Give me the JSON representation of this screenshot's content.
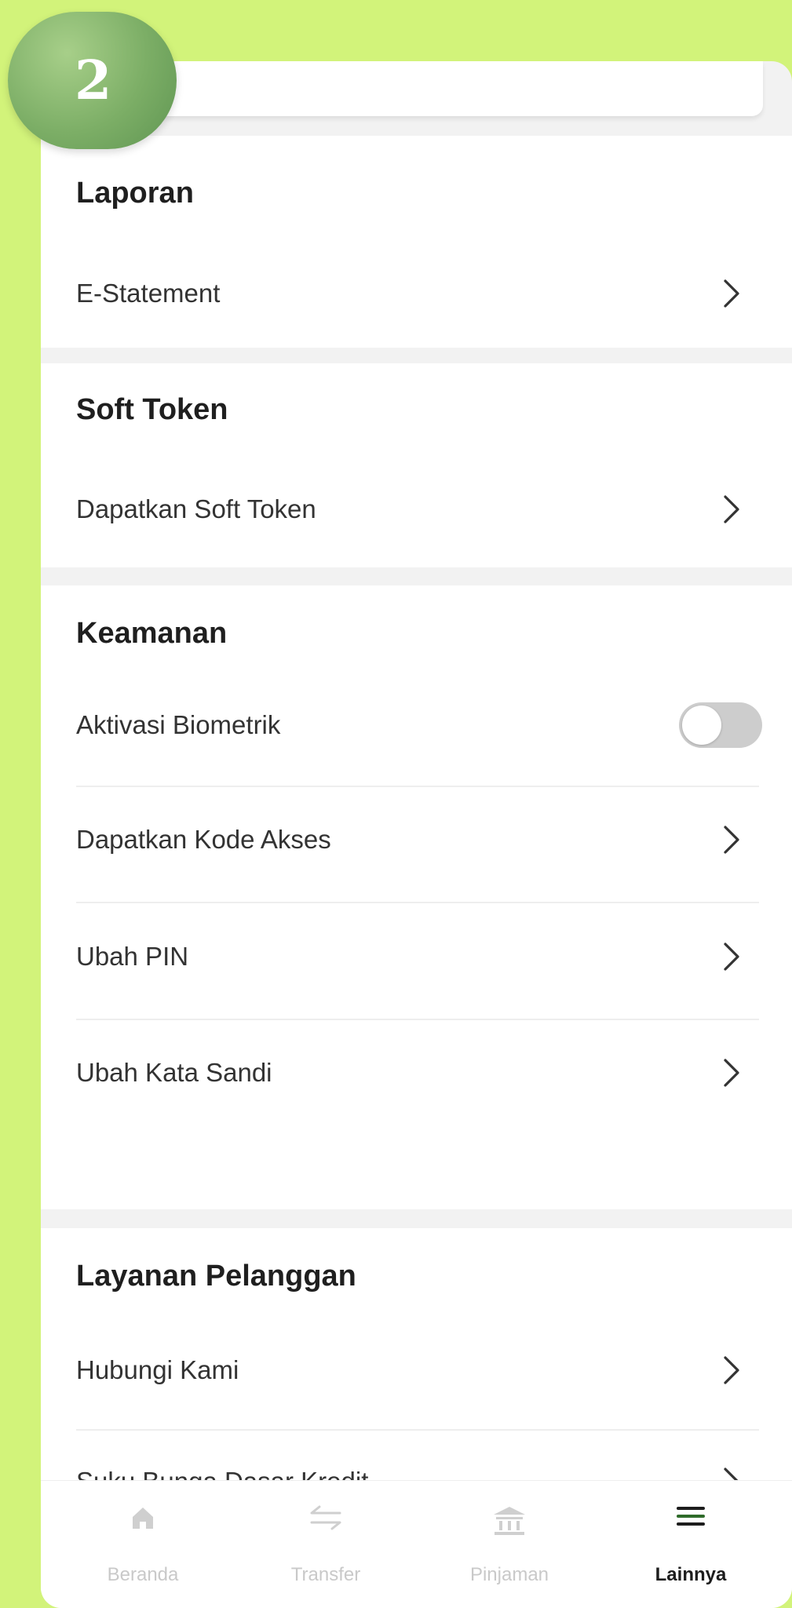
{
  "step": {
    "number": "2"
  },
  "sections": [
    {
      "title": "Laporan",
      "items": [
        {
          "label": "E-Statement",
          "type": "link"
        }
      ]
    },
    {
      "title": "Soft Token",
      "items": [
        {
          "label": "Dapatkan Soft Token",
          "type": "link"
        }
      ]
    },
    {
      "title": "Keamanan",
      "items": [
        {
          "label": "Aktivasi Biometrik",
          "type": "toggle",
          "enabled": false
        },
        {
          "label": "Dapatkan Kode Akses",
          "type": "link"
        },
        {
          "label": "Ubah PIN",
          "type": "link"
        },
        {
          "label": "Ubah Kata Sandi",
          "type": "link"
        }
      ]
    },
    {
      "title": "Layanan Pelanggan",
      "items": [
        {
          "label": "Hubungi Kami",
          "type": "link"
        },
        {
          "label": "Suku Bunga Dasar Kredit",
          "type": "link"
        }
      ]
    }
  ],
  "bottom_nav": {
    "items": [
      {
        "label": "Beranda",
        "icon": "home-icon",
        "active": false
      },
      {
        "label": "Transfer",
        "icon": "transfer-arrows-icon",
        "active": false
      },
      {
        "label": "Pinjaman",
        "icon": "bank-icon",
        "active": false
      },
      {
        "label": "Lainnya",
        "icon": "menu-icon",
        "active": true
      }
    ]
  },
  "colors": {
    "background": "#d2f37a",
    "badge": "#7cae66",
    "active_icon": "#2f6b2a",
    "inactive": "#c9c9c9"
  }
}
